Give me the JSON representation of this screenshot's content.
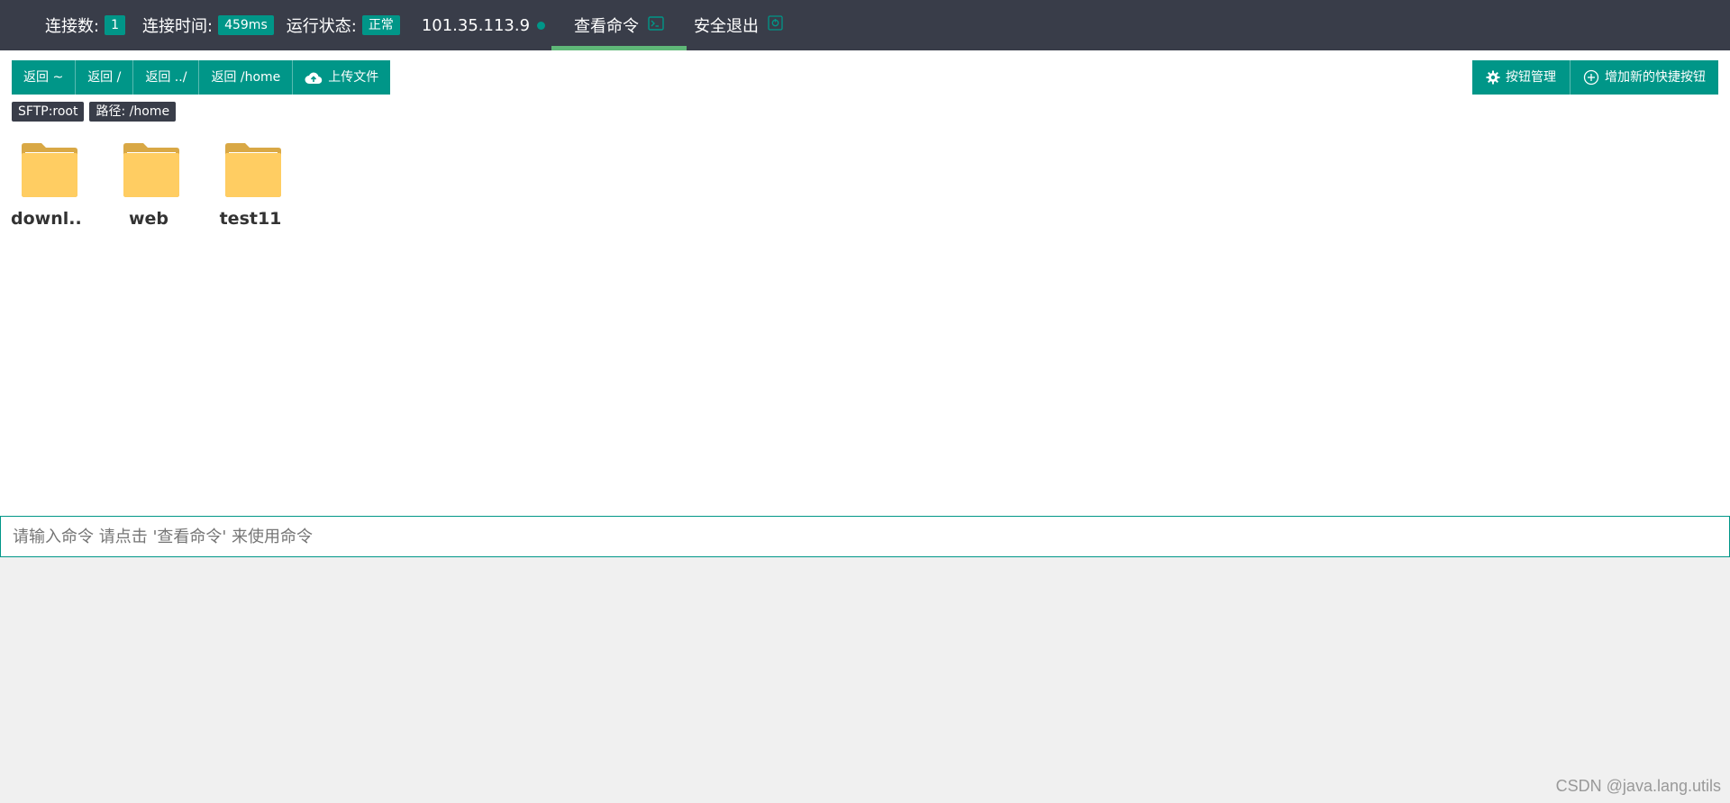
{
  "topbar": {
    "connections_label": "连接数:",
    "connections_value": "1",
    "conn_time_label": "连接时间:",
    "conn_time_value": "459ms",
    "status_label": "运行状态:",
    "status_value": "正常",
    "ip": "101.35.113.9",
    "view_command": "查看命令",
    "safe_exit": "安全退出",
    "accent_color": "#009688",
    "active_tab_color": "#5fb878"
  },
  "toolbar": {
    "left_buttons": [
      "返回 ~",
      "返回 /",
      "返回 ../",
      "返回 /home"
    ],
    "upload_label": "上传文件",
    "manage_label": "按钮管理",
    "add_shortcut_label": "增加新的快捷按钮"
  },
  "tags": {
    "sftp": "SFTP:root",
    "path": "路径: /home"
  },
  "files": [
    {
      "name": "downl...",
      "icon": "folder-icon"
    },
    {
      "name": "web",
      "icon": "folder-icon"
    },
    {
      "name": "test11",
      "icon": "folder-icon"
    }
  ],
  "command": {
    "placeholder": "请输入命令 请点击 '查看命令' 来使用命令",
    "value": ""
  },
  "watermark": "CSDN @java.lang.utils"
}
